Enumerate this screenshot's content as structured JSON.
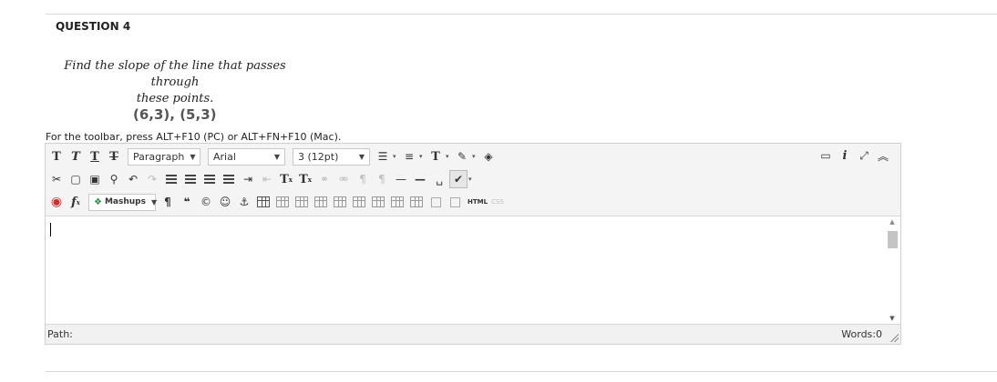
{
  "question": {
    "title": "QUESTION 4",
    "prompt_line1": "Find the slope of the line that passes through",
    "prompt_line2": "these points.",
    "points": "(6,3), (5,3)"
  },
  "editor": {
    "toolbar_hint": "For the toolbar, press ALT+F10 (PC) or ALT+FN+F10 (Mac).",
    "format_select": "Paragraph",
    "font_select": "Arial",
    "size_select": "3 (12pt)",
    "mashups_label": "Mashups",
    "html_label": "HTML",
    "css_label": "CSS",
    "text_glyph": "T",
    "path_label": "Path:",
    "word_count": "Words:0"
  },
  "colors": {
    "accent_red": "#e0272a",
    "toolbar_bg": "#f4f4f4"
  },
  "icons": [
    "bold-icon",
    "italic-icon",
    "underline-icon",
    "strikethrough-icon",
    "cut-icon",
    "copy-icon",
    "paste-icon",
    "find-icon",
    "undo-icon",
    "redo-icon",
    "align-left-icon",
    "align-center-icon",
    "align-right-icon",
    "align-justify-icon",
    "indent-icon",
    "outdent-icon",
    "superscript-icon",
    "subscript-icon",
    "link-icon",
    "unlink-icon",
    "ltr-icon",
    "rtl-icon",
    "hr-icon",
    "nbsp-icon",
    "spellcheck-icon",
    "record-icon",
    "formula-icon",
    "mashups-icon",
    "pilcrow-icon",
    "quote-icon",
    "copyright-icon",
    "emoticon-icon",
    "anchor-icon",
    "table-icon",
    "preview-icon",
    "info-icon",
    "fullscreen-icon",
    "collapse-icon"
  ]
}
